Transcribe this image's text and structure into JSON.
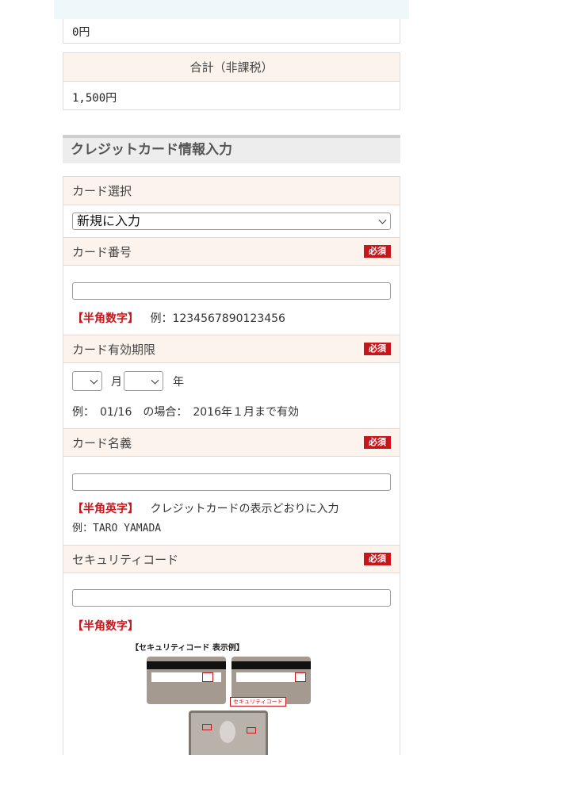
{
  "summary": {
    "prev_value": "0円",
    "total_header": "合計（非課税）",
    "total_value": "1,500円"
  },
  "section": {
    "title": "クレジットカード情報入力"
  },
  "card_select": {
    "label": "カード選択",
    "selected": "新規に入力"
  },
  "card_number": {
    "label": "カード番号",
    "required": "必須",
    "value": "",
    "hint_tag": "【半角数字】",
    "hint_example": "例：1234567890123456"
  },
  "expiry": {
    "label": "カード有効期限",
    "required": "必須",
    "month_value": "",
    "month_unit": "月",
    "year_value": "",
    "year_unit": "年",
    "example": "例：　01/16　の場合：　2016年１月まで有効"
  },
  "card_name": {
    "label": "カード名義",
    "required": "必須",
    "value": "",
    "hint_tag": "【半角英字】",
    "hint_text": "クレジットカードの表示どおりに入力",
    "example": "例：TARO YAMADA"
  },
  "security_code": {
    "label": "セキュリティコード",
    "required": "必須",
    "value": "",
    "hint_tag": "【半角数字】",
    "image_caption": "【セキュリティコード 表示例】",
    "image_label": "セキュリティコード"
  },
  "colors": {
    "accent_red": "#c8161d",
    "header_bg": "#fbf3ec",
    "section_bg": "#ededed",
    "top_strip": "#eef7fa"
  }
}
